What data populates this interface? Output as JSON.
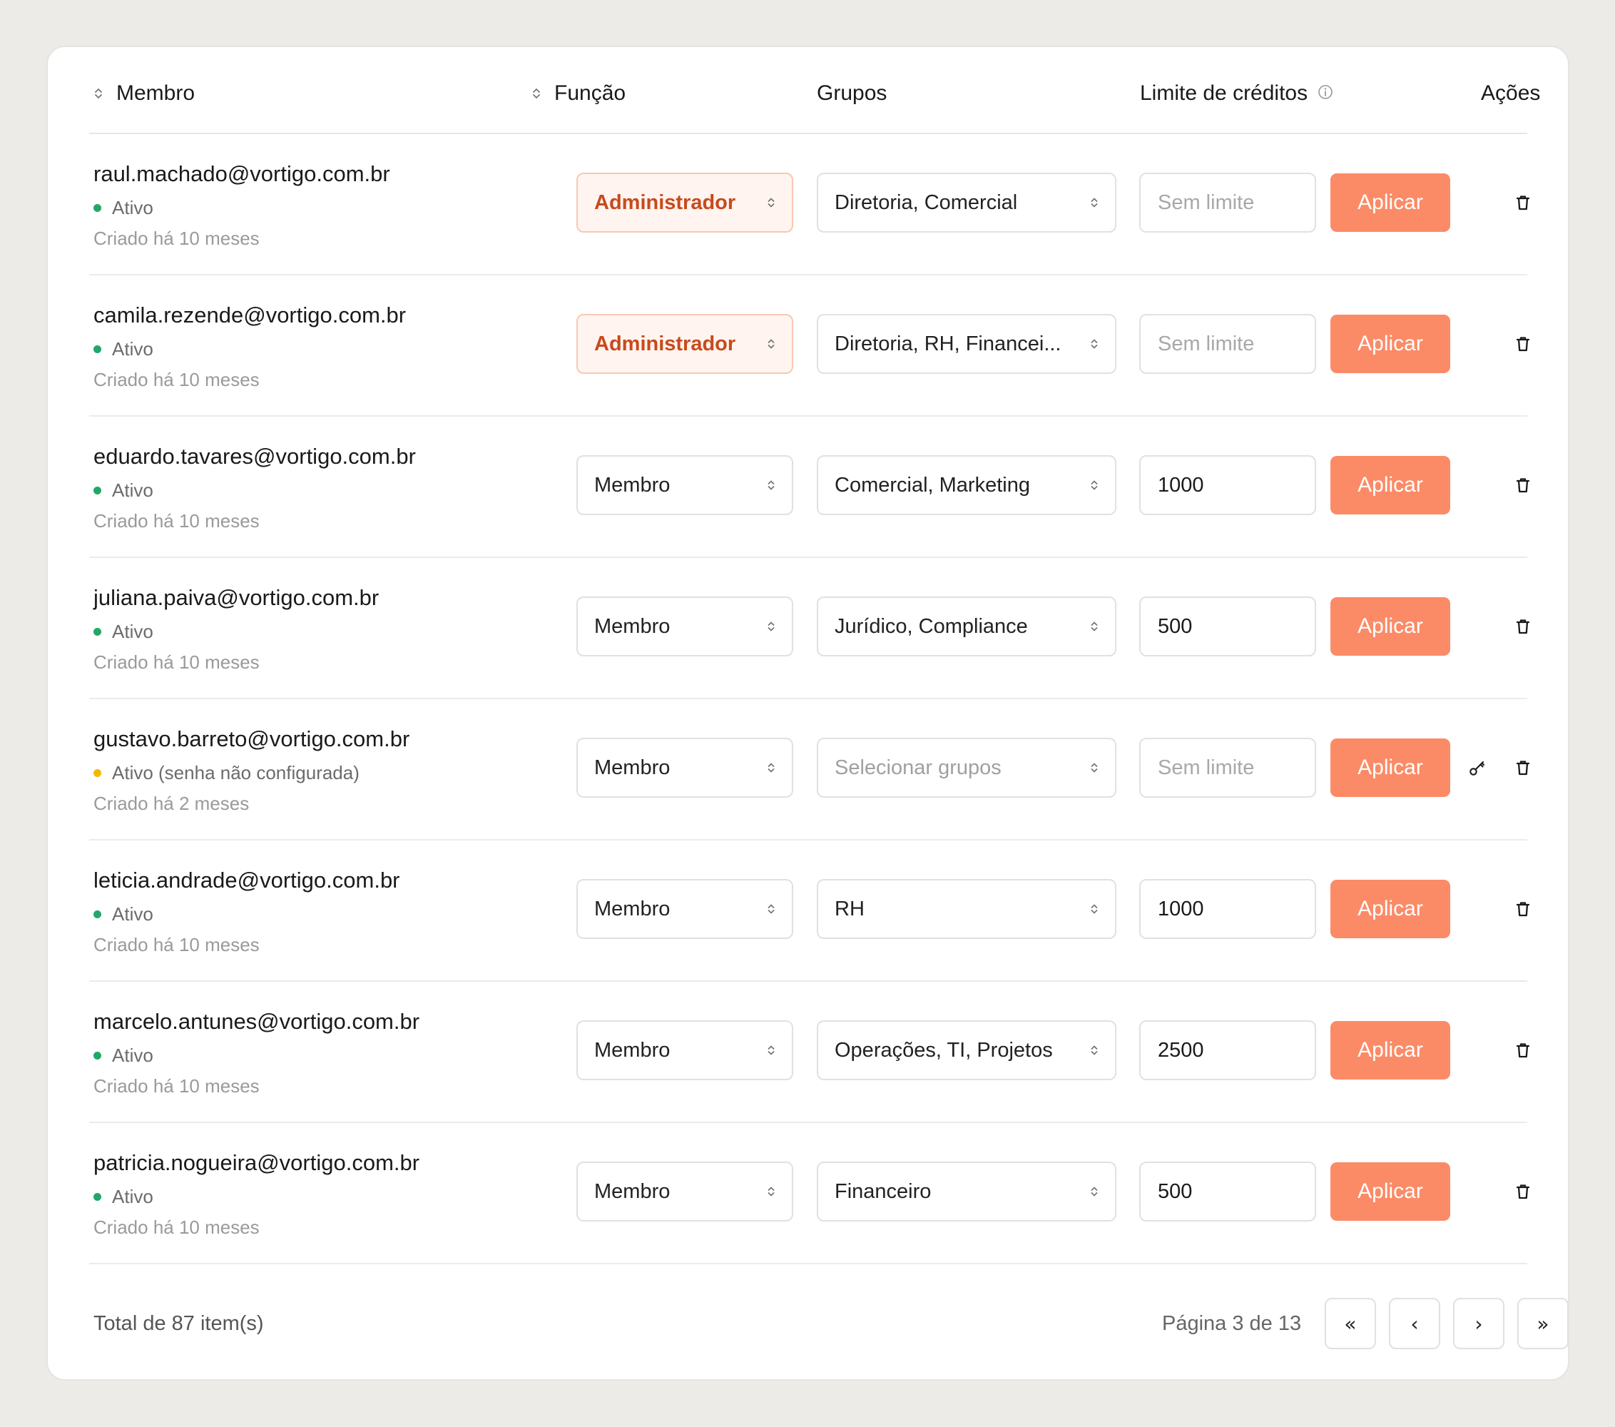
{
  "header": {
    "member": "Membro",
    "role": "Função",
    "groups": "Grupos",
    "credit_limit": "Limite de créditos",
    "actions": "Ações"
  },
  "rows": [
    {
      "email": "raul.machado@vortigo.com.br",
      "status": "Ativo",
      "status_color": "#22a866",
      "created": "Criado há 10 meses",
      "role": "Administrador",
      "groups": "Diretoria, Comercial",
      "credit": "",
      "credit_placeholder": "Sem limite",
      "apply": "Aplicar",
      "has_key": false
    },
    {
      "email": "camila.rezende@vortigo.com.br",
      "status": "Ativo",
      "status_color": "#22a866",
      "created": "Criado há 10 meses",
      "role": "Administrador",
      "groups": "Diretoria, RH, Financei...",
      "credit": "",
      "credit_placeholder": "Sem limite",
      "apply": "Aplicar",
      "has_key": false
    },
    {
      "email": "eduardo.tavares@vortigo.com.br",
      "status": "Ativo",
      "status_color": "#22a866",
      "created": "Criado há 10 meses",
      "role": "Membro",
      "groups": "Comercial, Marketing",
      "credit": "1000",
      "credit_placeholder": "Sem limite",
      "apply": "Aplicar",
      "has_key": false
    },
    {
      "email": "juliana.paiva@vortigo.com.br",
      "status": "Ativo",
      "status_color": "#22a866",
      "created": "Criado há 10 meses",
      "role": "Membro",
      "groups": "Jurídico, Compliance",
      "credit": "500",
      "credit_placeholder": "Sem limite",
      "apply": "Aplicar",
      "has_key": false
    },
    {
      "email": "gustavo.barreto@vortigo.com.br",
      "status": "Ativo (senha não configurada)",
      "status_color": "#f5b800",
      "created": "Criado há 2 meses",
      "role": "Membro",
      "groups": "",
      "groups_placeholder": "Selecionar grupos",
      "credit": "",
      "credit_placeholder": "Sem limite",
      "apply": "Aplicar",
      "has_key": true
    },
    {
      "email": "leticia.andrade@vortigo.com.br",
      "status": "Ativo",
      "status_color": "#22a866",
      "created": "Criado há 10 meses",
      "role": "Membro",
      "groups": "RH",
      "credit": "1000",
      "credit_placeholder": "Sem limite",
      "apply": "Aplicar",
      "has_key": false
    },
    {
      "email": "marcelo.antunes@vortigo.com.br",
      "status": "Ativo",
      "status_color": "#22a866",
      "created": "Criado há 10 meses",
      "role": "Membro",
      "groups": "Operações, TI, Projetos",
      "credit": "2500",
      "credit_placeholder": "Sem limite",
      "apply": "Aplicar",
      "has_key": false
    },
    {
      "email": "patricia.nogueira@vortigo.com.br",
      "status": "Ativo",
      "status_color": "#22a866",
      "created": "Criado há 10 meses",
      "role": "Membro",
      "groups": "Financeiro",
      "credit": "500",
      "credit_placeholder": "Sem limite",
      "apply": "Aplicar",
      "has_key": false
    }
  ],
  "footer": {
    "total": "Total de 87 item(s)",
    "page_info": "Página 3 de 13",
    "first": "«",
    "prev": "‹",
    "next": "›",
    "last": "»"
  },
  "colors": {
    "accent": "#fb8b67",
    "admin_text": "#c84a1c",
    "admin_bg": "#fff4ef",
    "active_dot": "#22a866",
    "warning_dot": "#f5b800",
    "page_bg": "#edebe7"
  }
}
